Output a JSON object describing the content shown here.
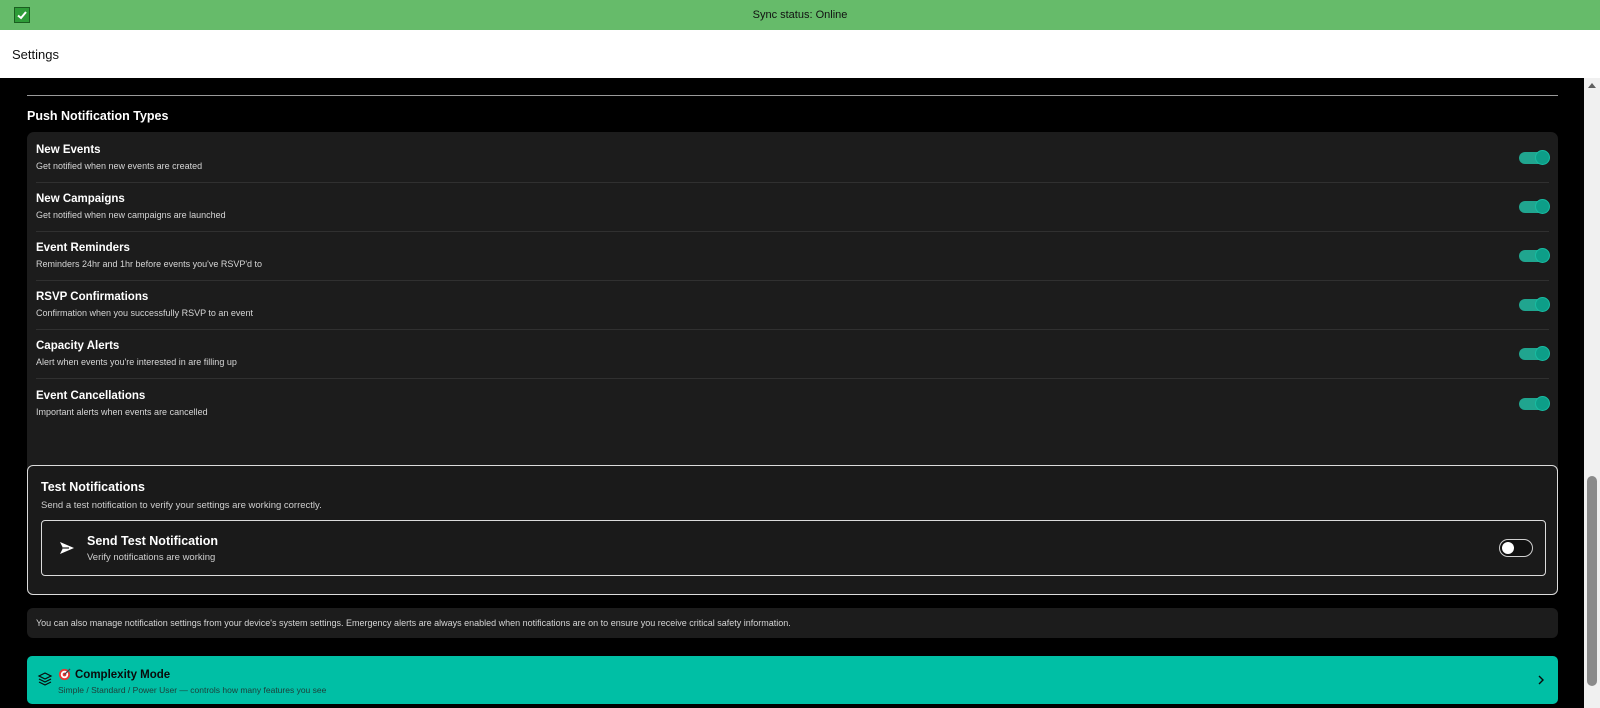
{
  "sync": {
    "status": "Sync status: Online",
    "icon": "checkbox-checked-icon"
  },
  "header": {
    "title": "Settings"
  },
  "push": {
    "heading": "Push Notification Types",
    "items": [
      {
        "title": "New Events",
        "desc": "Get notified when new events are created",
        "enabled": true
      },
      {
        "title": "New Campaigns",
        "desc": "Get notified when new campaigns are launched",
        "enabled": true
      },
      {
        "title": "Event Reminders",
        "desc": "Reminders 24hr and 1hr before events you've RSVP'd to",
        "enabled": true
      },
      {
        "title": "RSVP Confirmations",
        "desc": "Confirmation when you successfully RSVP to an event",
        "enabled": true
      },
      {
        "title": "Capacity Alerts",
        "desc": "Alert when events you're interested in are filling up",
        "enabled": true
      },
      {
        "title": "Event Cancellations",
        "desc": "Important alerts when events are cancelled",
        "enabled": true
      }
    ]
  },
  "test": {
    "title": "Test Notifications",
    "desc": "Send a test notification to verify your settings are working correctly.",
    "send_title": "Send Test Notification",
    "send_desc": "Verify notifications are working",
    "send_enabled": false
  },
  "info": {
    "text": "You can also manage notification settings from your device's system settings. Emergency alerts are always enabled when notifications are on to ensure you receive critical safety information."
  },
  "complexity": {
    "title": "Complexity Mode",
    "desc": "Simple / Standard / Power User — controls how many features you see"
  },
  "colors": {
    "accent": "#00bfa5",
    "sync_bar": "#66bb6a",
    "toggle_on": "#20a58f"
  }
}
